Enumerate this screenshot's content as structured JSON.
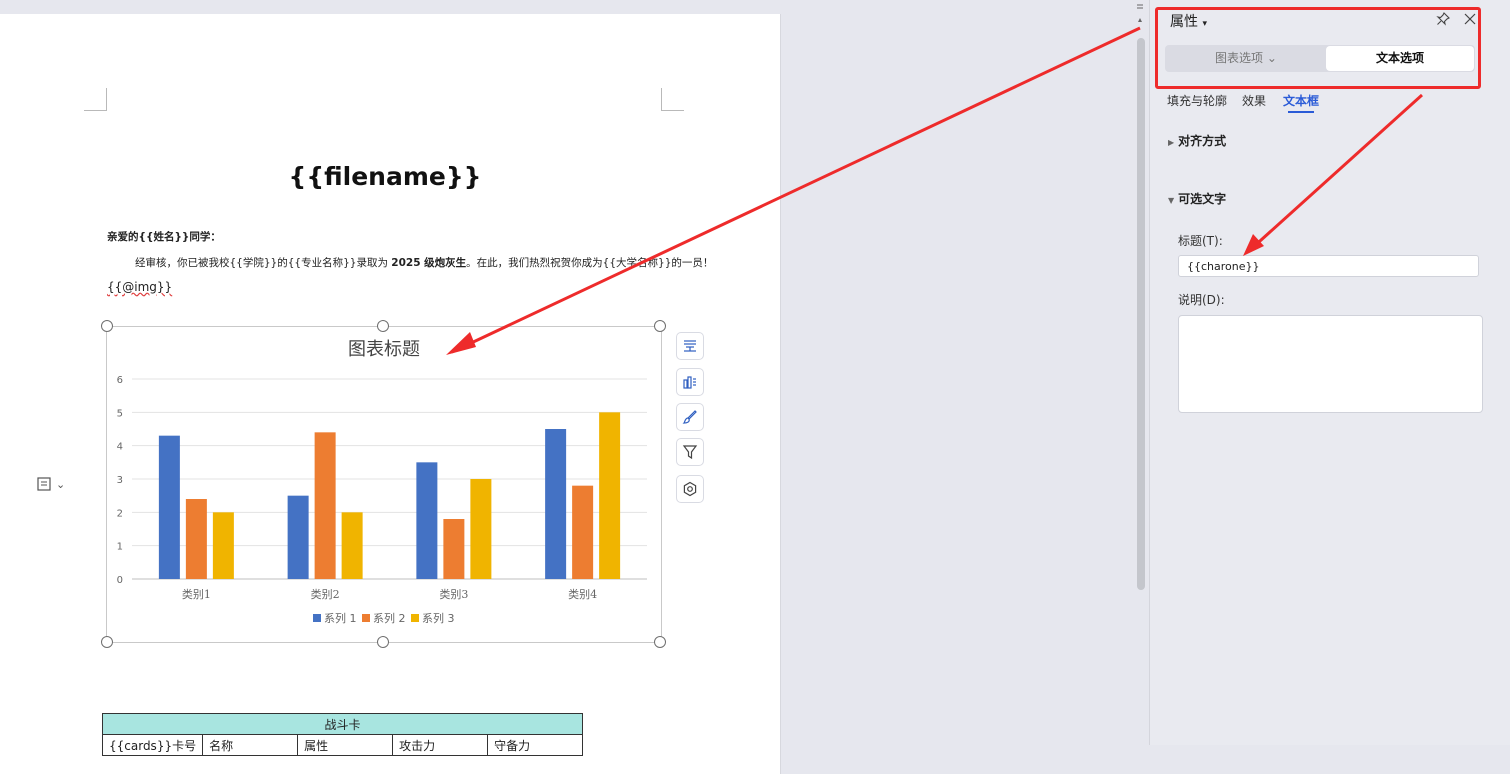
{
  "document": {
    "title": "{{filename}}",
    "salutation": "亲爱的{{姓名}}同学：",
    "body_before_bold": "经审核，你已被我校{{学院}}的{{专业名称}}录取为 ",
    "body_bold": "2025 级炮灰生",
    "body_after_bold": "。在此，我们热烈祝贺你成为{{大学名称}}的一员！",
    "img_placeholder": "{{@img}}"
  },
  "chart_data": {
    "type": "bar",
    "title": "图表标题",
    "categories": [
      "类别1",
      "类别2",
      "类别3",
      "类别4"
    ],
    "series": [
      {
        "name": "系列 1",
        "values": [
          4.3,
          2.5,
          3.5,
          4.5
        ],
        "color": "#4472c4"
      },
      {
        "name": "系列 2",
        "values": [
          2.4,
          4.4,
          1.8,
          2.8
        ],
        "color": "#ed7d31"
      },
      {
        "name": "系列 3",
        "values": [
          2.0,
          2.0,
          3.0,
          5.0
        ],
        "color": "#f0b400"
      }
    ],
    "ylim": [
      0,
      6
    ],
    "yticks": [
      0,
      1,
      2,
      3,
      4,
      5,
      6
    ],
    "grid": true,
    "legend_position": "bottom"
  },
  "chart_tools": {
    "icons": [
      "chart-elements-icon",
      "chart-style-icon",
      "chart-brush-icon",
      "chart-filter-icon",
      "chart-settings-icon"
    ]
  },
  "card_table": {
    "title": "战斗卡",
    "headers": [
      "{{cards}}卡号",
      "名称",
      "属性",
      "攻击力",
      "守备力"
    ]
  },
  "pane": {
    "title": "属性",
    "segments": {
      "chart_options": "图表选项",
      "text_options": "文本选项"
    },
    "subtabs": {
      "fill": "填充与轮廓",
      "effects": "效果",
      "textbox": "文本框"
    },
    "sections": {
      "alignment": "对齐方式",
      "alt_text": "可选文字"
    },
    "alt_title_label": "标题(T):",
    "alt_title_value": "{{charone}}",
    "alt_desc_label": "说明(D):"
  },
  "colors": {
    "annotation": "#ee2b2b",
    "accent": "#2a5bd7",
    "card_header": "#a8e5e0"
  }
}
